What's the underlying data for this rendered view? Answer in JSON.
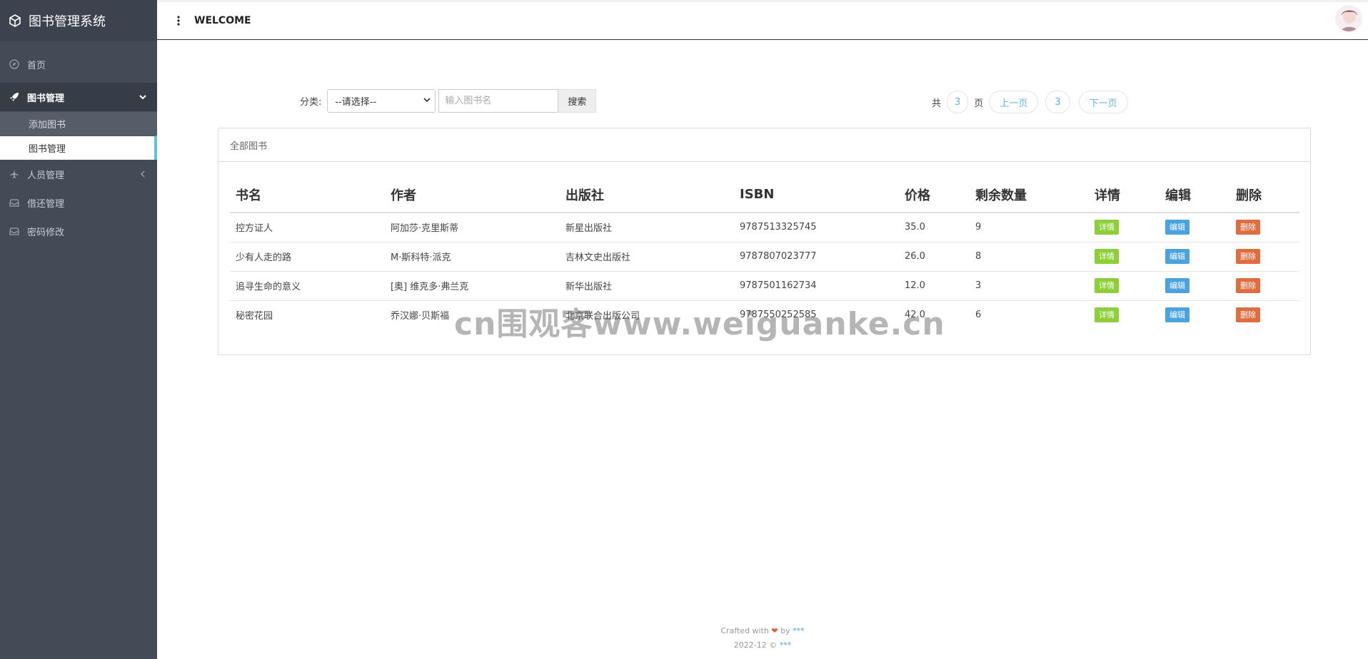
{
  "app": {
    "title": "图书管理系统"
  },
  "header": {
    "welcome": "WELCOME"
  },
  "sidebar": {
    "home": "首页",
    "books": "图书管理",
    "book_sub": [
      "添加图书",
      "图书管理"
    ],
    "people": "人员管理",
    "borrow": "借还管理",
    "password": "密码修改"
  },
  "filter": {
    "label": "分类:",
    "select_value": "--请选择--",
    "search_placeholder": "输入图书名",
    "search_button": "搜索"
  },
  "pager": {
    "prefix": "共",
    "total_pages": "3",
    "suffix": "页",
    "prev": "上一页",
    "current": "3",
    "next": "下一页"
  },
  "panel": {
    "title": "全部图书"
  },
  "table": {
    "headers": [
      "书名",
      "作者",
      "出版社",
      "ISBN",
      "价格",
      "剩余数量",
      "详情",
      "编辑",
      "删除"
    ],
    "rows": [
      [
        "控方证人",
        "阿加莎·克里斯蒂",
        "新星出版社",
        "9787513325745",
        "35.0",
        "9"
      ],
      [
        "少有人走的路",
        "M·斯科特·派克",
        "吉林文史出版社",
        "9787807023777",
        "26.0",
        "8"
      ],
      [
        "追寻生命的意义",
        "[奥] 维克多·弗兰克",
        "新华出版社",
        "9787501162734",
        "12.0",
        "3"
      ],
      [
        "秘密花园",
        "乔汉娜·贝斯福",
        "北京联合出版公司",
        "9787550252585",
        "42.0",
        "6"
      ]
    ],
    "btn_detail": "详情",
    "btn_edit": "编辑",
    "btn_delete": "删除"
  },
  "watermark": "cn围观客www.weiguanke.cn",
  "footer": {
    "crafted": "Crafted with",
    "by": "by",
    "author": "***",
    "year": "2022-12 ©",
    "owner": "***"
  },
  "colors": {
    "sidebar": "#434b57",
    "accent": "#5cc4d4",
    "detail": "#8ccf39",
    "edit": "#4aa3df",
    "delete": "#e06d3f"
  }
}
